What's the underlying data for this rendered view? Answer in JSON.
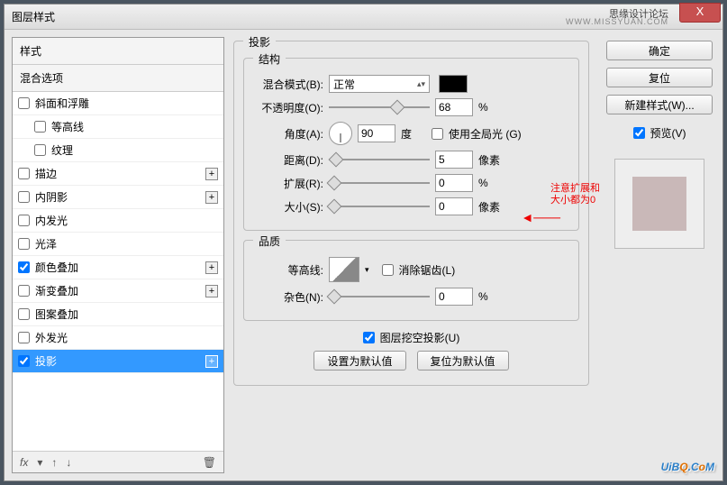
{
  "titlebar": {
    "title": "图层样式",
    "forum": "思缘设计论坛",
    "url": "WWW.MISSYUAN.COM",
    "close": "X"
  },
  "sidebar": {
    "styles_header": "样式",
    "blend_header": "混合选项",
    "items": [
      {
        "label": "斜面和浮雕",
        "checked": false,
        "plus": false
      },
      {
        "label": "等高线",
        "checked": false,
        "plus": false,
        "indent": true
      },
      {
        "label": "纹理",
        "checked": false,
        "plus": false,
        "indent": true
      },
      {
        "label": "描边",
        "checked": false,
        "plus": true
      },
      {
        "label": "内阴影",
        "checked": false,
        "plus": true
      },
      {
        "label": "内发光",
        "checked": false,
        "plus": false
      },
      {
        "label": "光泽",
        "checked": false,
        "plus": false
      },
      {
        "label": "颜色叠加",
        "checked": true,
        "plus": true
      },
      {
        "label": "渐变叠加",
        "checked": false,
        "plus": true
      },
      {
        "label": "图案叠加",
        "checked": false,
        "plus": false
      },
      {
        "label": "外发光",
        "checked": false,
        "plus": false
      },
      {
        "label": "投影",
        "checked": true,
        "plus": true,
        "selected": true
      }
    ],
    "fx": "fx"
  },
  "main": {
    "panel_title": "投影",
    "structure": {
      "title": "结构",
      "blend_mode_label": "混合模式(B):",
      "blend_mode_value": "正常",
      "opacity_label": "不透明度(O):",
      "opacity_value": "68",
      "opacity_unit": "%",
      "angle_label": "角度(A):",
      "angle_value": "90",
      "angle_unit": "度",
      "global_light": "使用全局光 (G)",
      "global_checked": false,
      "distance_label": "距离(D):",
      "distance_value": "5",
      "distance_unit": "像素",
      "spread_label": "扩展(R):",
      "spread_value": "0",
      "spread_unit": "%",
      "size_label": "大小(S):",
      "size_value": "0",
      "size_unit": "像素"
    },
    "quality": {
      "title": "品质",
      "contour_label": "等高线:",
      "antialias": "消除锯齿(L)",
      "antialias_checked": false,
      "noise_label": "杂色(N):",
      "noise_value": "0",
      "noise_unit": "%"
    },
    "knockout": {
      "label": "图层挖空投影(U)",
      "checked": true
    },
    "reset_default": "设置为默认值",
    "make_default": "复位为默认值",
    "annotation": "注意扩展和\n大小都为0"
  },
  "right": {
    "ok": "确定",
    "cancel": "复位",
    "new_style": "新建样式(W)...",
    "preview": "预览(V)",
    "preview_checked": true
  },
  "watermark": {
    "text_a": "UiB",
    "text_b": "Q",
    "text_c": ".C",
    "text_d": "o",
    "text_e": "M"
  }
}
